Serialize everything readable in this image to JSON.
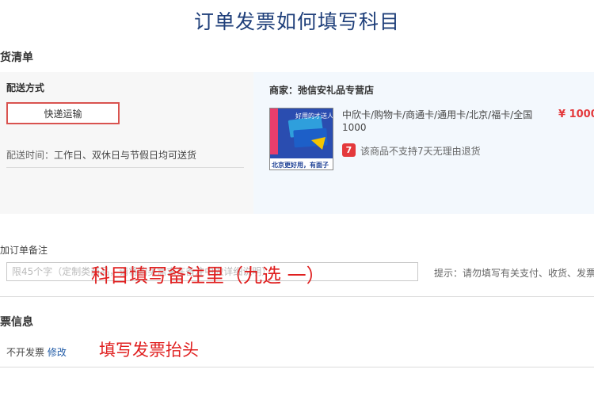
{
  "page_title": "订单发票如何填写科目",
  "delivery_list": {
    "heading": "货清单",
    "method_label": "配送方式",
    "method_button": "快递运输",
    "time_label": "配送时间：",
    "time_value": "工作日、双休日与节假日均可送货"
  },
  "shop": {
    "label": "商家：弛信安礼品专营店",
    "product": {
      "image_text_top": "好用的才送人",
      "image_text_bottom": "北京更好用，有面子",
      "title": "中欣卡/购物卡/商通卡/通用卡/北京/福卡/全国",
      "title_line2": "1000",
      "price": "¥ 1000",
      "return_badge": "7",
      "return_text": "该商品不支持7天无理由退货"
    }
  },
  "order_note": {
    "label": "加订单备注",
    "placeholder": "限45个字（定制类商品，请将购买需求在备注中做详细说明）",
    "tip": "提示：请勿填写有关支付、收货、发票"
  },
  "invoice": {
    "heading": "票信息",
    "status": "不开发票",
    "edit_link": "修改"
  },
  "annotations": {
    "note_hint": "科目填写备注里（九选 一）",
    "invoice_hint": "填写发票抬头"
  },
  "colors": {
    "title": "#1f3f7a",
    "price": "#e4393c",
    "annotation": "#e02020",
    "link": "#1f5aa6"
  }
}
